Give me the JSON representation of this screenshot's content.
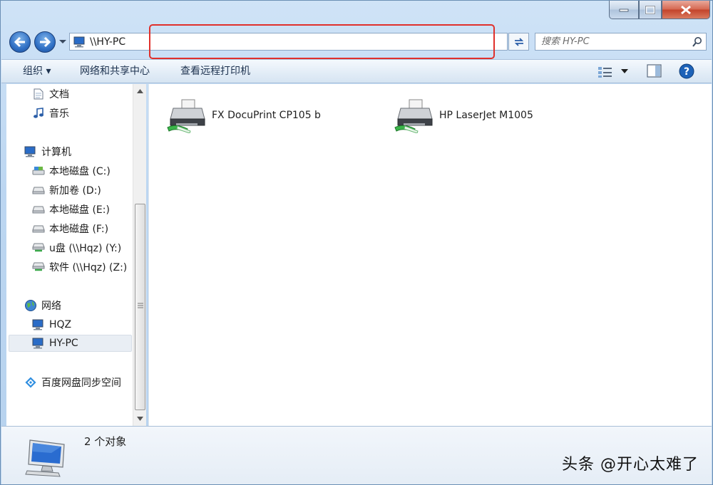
{
  "window": {
    "address": "\\\\HY-PC",
    "search_placeholder": "搜索 HY-PC"
  },
  "toolbar": {
    "organize": "组织 ▾",
    "network_center": "网络和共享中心",
    "remote_printers": "查看远程打印机"
  },
  "nav": {
    "documents": "文档",
    "music": "音乐",
    "computer": "计算机",
    "drive_c": "本地磁盘 (C:)",
    "drive_d": "新加卷 (D:)",
    "drive_e": "本地磁盘 (E:)",
    "drive_f": "本地磁盘 (F:)",
    "drive_y": "u盘 (\\\\Hqz) (Y:)",
    "drive_z": "软件 (\\\\Hqz) (Z:)",
    "network": "网络",
    "hqz": "HQZ",
    "hypc": "HY-PC",
    "baidu": "百度网盘同步空间"
  },
  "content": {
    "printers": [
      {
        "name": "FX DocuPrint CP105 b"
      },
      {
        "name": "HP LaserJet M1005"
      }
    ]
  },
  "details": {
    "count": "2 个对象"
  },
  "watermark": "头条 @开心太难了",
  "colors": {
    "frame": "#bcd6f1",
    "highlight": "#e0302b",
    "selection": "#e9eef4"
  }
}
